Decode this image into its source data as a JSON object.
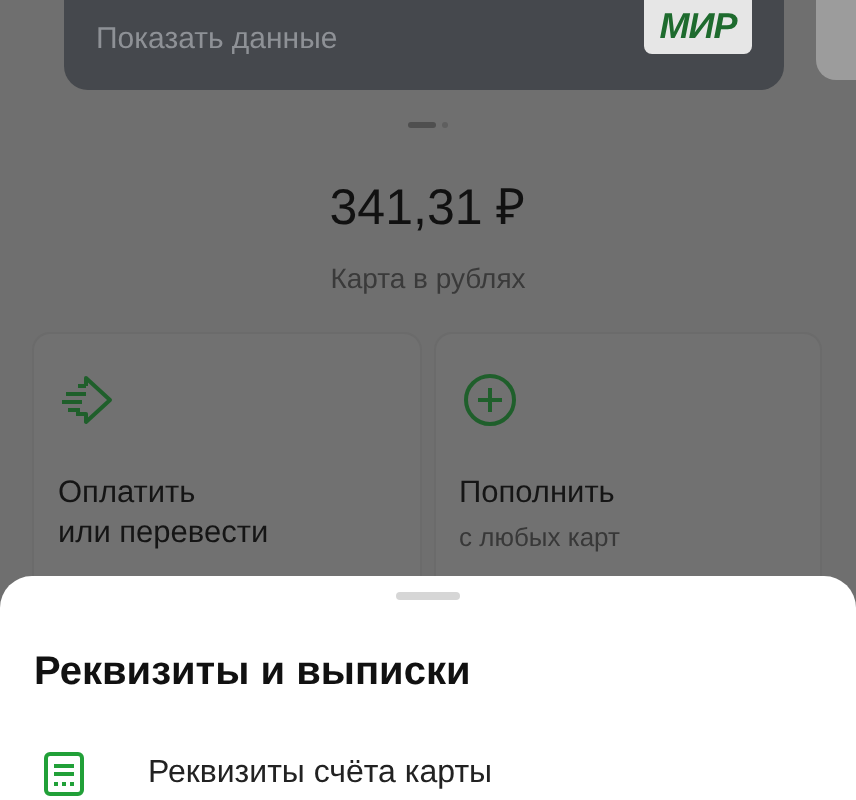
{
  "card": {
    "action": "Показать данные",
    "logo": "МИР"
  },
  "pager": [
    {
      "selected": true
    },
    {
      "selected": false
    }
  ],
  "balance": {
    "amount": "341,31 ₽",
    "caption": "Карта в рублях"
  },
  "tiles": [
    {
      "kind": "transfer",
      "title": "Оплатить\nили перевести"
    },
    {
      "kind": "topup",
      "title": "Пополнить",
      "subtitle": "с любых карт"
    }
  ],
  "sheet": {
    "title": "Реквизиты и выписки",
    "items": [
      {
        "label": "Реквизиты счёта карты"
      }
    ]
  }
}
